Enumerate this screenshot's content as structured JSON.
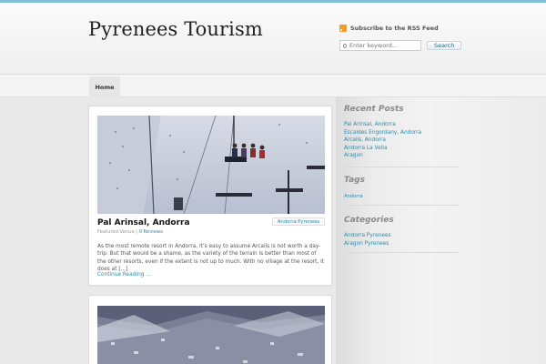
{
  "site": {
    "title": "Pyrenees Tourism",
    "rss_label": "Subscribe to the RSS Feed",
    "search_placeholder": "Enter keyword...",
    "search_button": "Search"
  },
  "nav": {
    "home": "Home"
  },
  "posts": [
    {
      "title": "Pal Arinsal, Andorra",
      "category": "Andorra Pyrenees",
      "meta_prefix": "Featured Venue",
      "meta_sep": " | ",
      "reviews": "0 Reviews",
      "excerpt": "As the most remote resort in Andorra, it’s easy to assume Arcalís is not worth a day-trip. But that would be a shame, as the variety of the terrain is better than most of the other resorts, even if the extent is not up to much. With no village at the resort, it does at [...]",
      "more": "Continue Reading ..."
    }
  ],
  "sidebar": {
    "recent_title": "Recent Posts",
    "recent": [
      "Pal Arinsal, Andorra",
      "Escaldes Engordany, Andorra",
      "Arcalis, Andorra",
      "Andorra La Vella",
      "Aragon"
    ],
    "tags_title": "Tags",
    "tags": [
      "Andorra"
    ],
    "categories_title": "Categories",
    "categories": [
      "Andorra Pyrenees",
      "Aragon Pyrenees"
    ]
  },
  "colors": {
    "accent": "#2f8aa6",
    "topbar": "#7dc3d3",
    "rss": "#f29a2e"
  }
}
